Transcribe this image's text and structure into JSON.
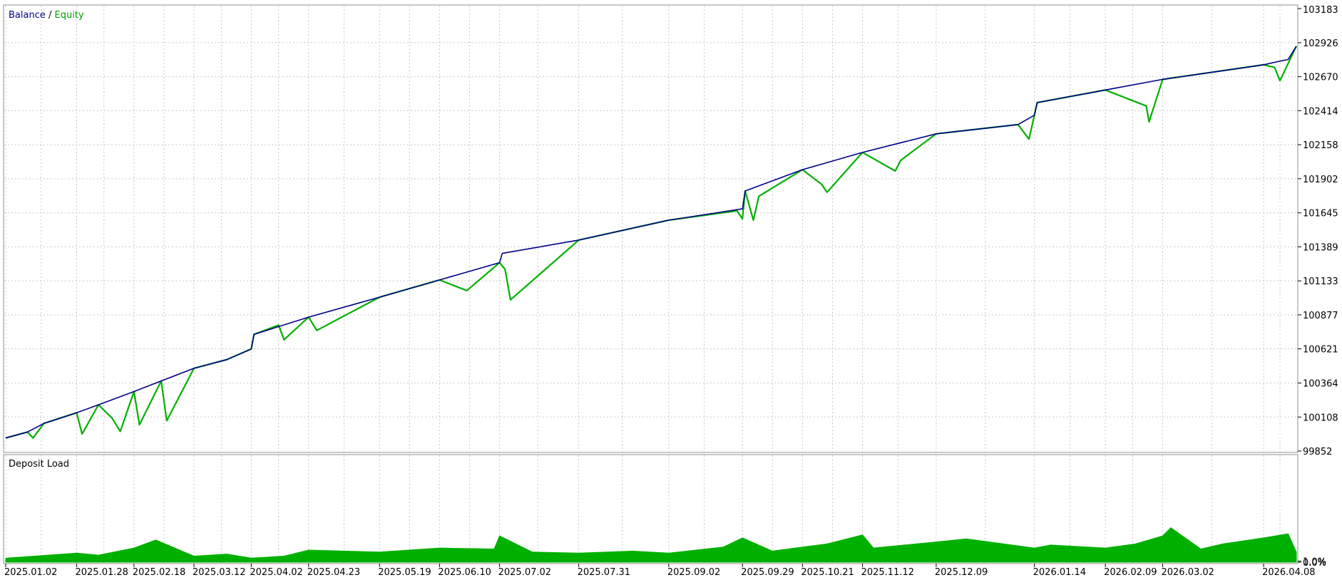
{
  "chart_data": [
    {
      "type": "line",
      "legend": [
        {
          "name": "Balance",
          "color": "#00008b"
        },
        {
          "name": "Equity",
          "color": "#00b000"
        }
      ],
      "legend_separator": " / ",
      "legend_placement": "top-left",
      "ylim": [
        99852,
        103183
      ],
      "yticks": [
        "103183",
        "102926",
        "102670",
        "102414",
        "102158",
        "101902",
        "101645",
        "101389",
        "101133",
        "100877",
        "100621",
        "100364",
        "100108",
        "99852"
      ],
      "xlim": [
        "2025-01-02",
        "2026-04-20"
      ],
      "grid": true,
      "series": [
        {
          "name": "Balance",
          "color": "#00008b",
          "x": [
            "2025-01-02",
            "2025-01-10",
            "2025-01-16",
            "2025-01-28",
            "2025-02-05",
            "2025-02-18",
            "2025-02-28",
            "2025-03-12",
            "2025-03-24",
            "2025-04-02",
            "2025-04-03",
            "2025-04-23",
            "2025-05-19",
            "2025-06-10",
            "2025-07-02",
            "2025-07-03",
            "2025-07-31",
            "2025-09-02",
            "2025-09-29",
            "2025-09-30",
            "2025-10-21",
            "2025-11-12",
            "2025-12-09",
            "2026-01-08",
            "2026-01-14",
            "2026-01-15",
            "2026-02-09",
            "2026-03-02",
            "2026-04-08",
            "2026-04-17",
            "2026-04-20"
          ],
          "values": [
            99950,
            99995,
            100060,
            100140,
            100200,
            100300,
            100380,
            100475,
            100540,
            100620,
            100730,
            100860,
            101010,
            101140,
            101270,
            101340,
            101440,
            101590,
            101675,
            101810,
            101970,
            102100,
            102240,
            102310,
            102380,
            102475,
            102570,
            102650,
            102760,
            102800,
            102900
          ]
        },
        {
          "name": "Equity",
          "color": "#00b000",
          "x": [
            "2025-01-02",
            "2025-01-10",
            "2025-01-12",
            "2025-01-16",
            "2025-01-28",
            "2025-01-30",
            "2025-02-05",
            "2025-02-10",
            "2025-02-13",
            "2025-02-18",
            "2025-02-20",
            "2025-02-28",
            "2025-03-02",
            "2025-03-12",
            "2025-03-24",
            "2025-04-02",
            "2025-04-03",
            "2025-04-12",
            "2025-04-14",
            "2025-04-23",
            "2025-04-26",
            "2025-05-19",
            "2025-06-10",
            "2025-06-20",
            "2025-07-02",
            "2025-07-04",
            "2025-07-06",
            "2025-07-31",
            "2025-09-02",
            "2025-09-27",
            "2025-09-29",
            "2025-09-30",
            "2025-10-03",
            "2025-10-05",
            "2025-10-21",
            "2025-10-28",
            "2025-10-30",
            "2025-11-12",
            "2025-11-24",
            "2025-11-26",
            "2025-12-09",
            "2026-01-08",
            "2026-01-12",
            "2026-01-14",
            "2026-01-15",
            "2026-02-09",
            "2026-02-24",
            "2026-02-25",
            "2026-03-02",
            "2026-04-08",
            "2026-04-12",
            "2026-04-14",
            "2026-04-20"
          ],
          "values": [
            99950,
            99995,
            99950,
            100060,
            100140,
            99980,
            100200,
            100100,
            100000,
            100300,
            100050,
            100380,
            100080,
            100475,
            100540,
            100620,
            100730,
            100800,
            100690,
            100860,
            100760,
            101010,
            101140,
            101060,
            101270,
            101220,
            100990,
            101440,
            101590,
            101660,
            101600,
            101810,
            101590,
            101770,
            101970,
            101860,
            101800,
            102100,
            101960,
            102040,
            102240,
            102310,
            102200,
            102380,
            102475,
            102570,
            102450,
            102330,
            102650,
            102760,
            102740,
            102640,
            102900
          ]
        }
      ]
    },
    {
      "type": "area",
      "title": "Deposit Load",
      "ylim": [
        0,
        1
      ],
      "yticks": [
        "1.0%",
        "0.0%"
      ],
      "grid": true,
      "color": "#00b000",
      "series": [
        {
          "name": "Deposit Load",
          "x": [
            "2025-01-02",
            "2025-01-28",
            "2025-02-05",
            "2025-02-18",
            "2025-02-26",
            "2025-03-12",
            "2025-03-24",
            "2025-04-02",
            "2025-04-14",
            "2025-04-23",
            "2025-05-19",
            "2025-06-10",
            "2025-06-30",
            "2025-07-02",
            "2025-07-14",
            "2025-07-31",
            "2025-08-20",
            "2025-09-02",
            "2025-09-22",
            "2025-09-29",
            "2025-10-10",
            "2025-10-21",
            "2025-10-30",
            "2025-11-12",
            "2025-11-16",
            "2025-12-09",
            "2025-12-20",
            "2026-01-14",
            "2026-01-20",
            "2026-02-09",
            "2026-02-20",
            "2026-03-02",
            "2026-03-05",
            "2026-03-16",
            "2026-03-24",
            "2026-04-08",
            "2026-04-17",
            "2026-04-20"
          ],
          "values": [
            0.04,
            0.09,
            0.07,
            0.14,
            0.22,
            0.06,
            0.08,
            0.04,
            0.06,
            0.12,
            0.1,
            0.14,
            0.13,
            0.26,
            0.1,
            0.09,
            0.11,
            0.09,
            0.15,
            0.24,
            0.11,
            0.15,
            0.18,
            0.27,
            0.14,
            0.2,
            0.23,
            0.14,
            0.17,
            0.14,
            0.18,
            0.26,
            0.34,
            0.13,
            0.18,
            0.24,
            0.28,
            0.1
          ]
        }
      ],
      "xtick_labels": [
        "2025.01.02",
        "2025.01.28",
        "2025.02.18",
        "2025.03.12",
        "2025.04.02",
        "2025.04.23",
        "2025.05.19",
        "2025.06.10",
        "2025.07.02",
        "2025.07.31",
        "2025.09.02",
        "2025.09.29",
        "2025.10.21",
        "2025.11.12",
        "2025.12.09",
        "2026.01.14",
        "2026.02.09",
        "2026.03.02",
        "2026.04.08"
      ]
    }
  ]
}
